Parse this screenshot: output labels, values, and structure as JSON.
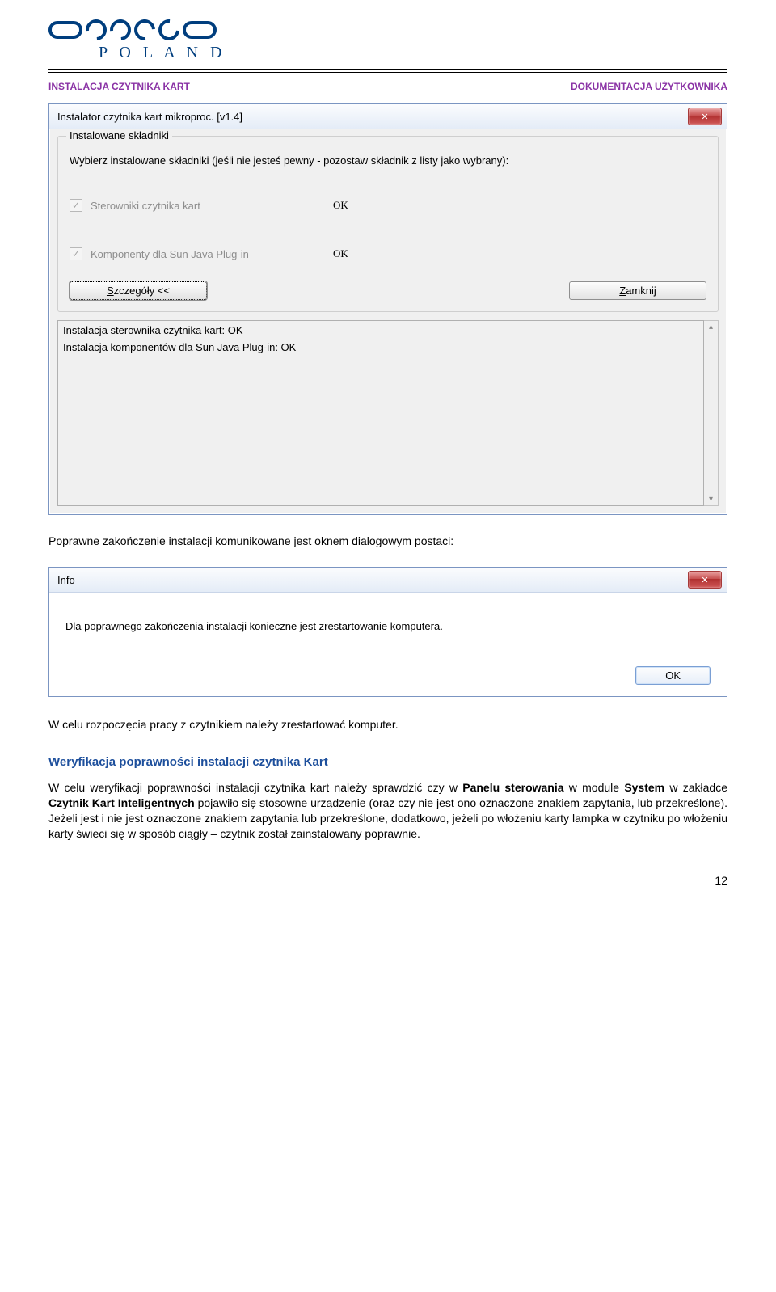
{
  "header": {
    "poland": "P O L A N D",
    "left_label": "INSTALACJA CZYTNIKA KART",
    "right_label": "DOKUMENTACJA  UŻYTKOWNIKA"
  },
  "win1": {
    "title": "Instalator czytnika kart mikroproc. [v1.4]",
    "close_x": "✕",
    "group_legend": "Instalowane składniki",
    "instruction": "Wybierz instalowane składniki (jeśli nie jesteś pewny - pozostaw składnik z listy jako wybrany):",
    "opt1_label": "Sterowniki czytnika kart",
    "opt1_status": "OK",
    "opt2_label": "Komponenty dla Sun Java Plug-in",
    "opt2_status": "OK",
    "details_btn_pre": "S",
    "details_btn_rest": "zczegóły <<",
    "close_btn_pre": "Z",
    "close_btn_rest": "amknij",
    "log_line1": "Instalacja sterownika czytnika kart: OK",
    "log_line2": "Instalacja komponentów dla Sun Java Plug-in: OK",
    "arrow_up": "▴",
    "arrow_down": "▾"
  },
  "text1": "Poprawne zakończenie instalacji komunikowane jest oknem dialogowym postaci:",
  "info": {
    "title": "Info",
    "close_x": "✕",
    "msg": "Dla poprawnego zakończenia instalacji konieczne jest zrestartowanie komputera.",
    "ok": "OK"
  },
  "text2": "W celu rozpoczęcia pracy z czytnikiem należy zrestartować komputer.",
  "section_title": "Weryfikacja poprawności instalacji czytnika Kart",
  "para_parts": {
    "p1": "W celu weryfikacji poprawności instalacji czytnika kart należy sprawdzić czy w ",
    "b1": "Panelu sterowania",
    "p2": " w module ",
    "b2": "System",
    "p3": " w zakładce ",
    "b3": "Czytnik Kart Inteligentnych",
    "p4": " pojawiło się stosowne urządzenie (oraz czy nie jest ono oznaczone znakiem zapytania, lub przekreślone). Jeżeli jest i nie jest oznaczone znakiem zapytania lub przekreślone, dodatkowo, jeżeli po włożeniu karty lampka w czytniku po włożeniu karty świeci się w sposób ciągły – czytnik został zainstalowany poprawnie."
  },
  "page_num": "12"
}
